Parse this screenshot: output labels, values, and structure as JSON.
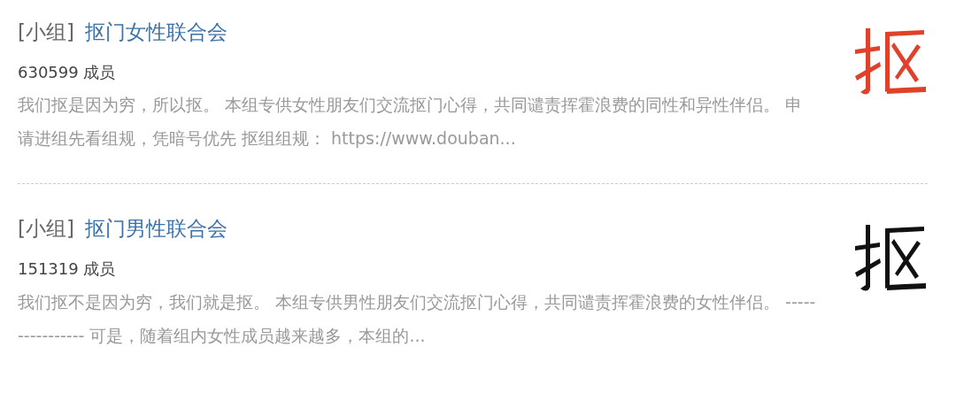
{
  "results": [
    {
      "tag": "[小组]",
      "title": "抠门女性联合会",
      "members": "630599 成员",
      "description": "我们抠是因为穷，所以抠。 本组专供女性朋友们交流抠门心得，共同谴责挥霍浪费的同性和异性伴侣。 申请进组先看组规，凭暗号优先 抠组组规： https://www.douban..."
    },
    {
      "tag": "[小组]",
      "title": "抠门男性联合会",
      "members": "151319 成员",
      "description": "我们抠不是因为穷，我们就是抠。 本组专供男性朋友们交流抠门心得，共同谴责挥霍浪费的女性伴侣。 ---------------- 可是，随着组内女性成员越来越多，本组的..."
    }
  ]
}
